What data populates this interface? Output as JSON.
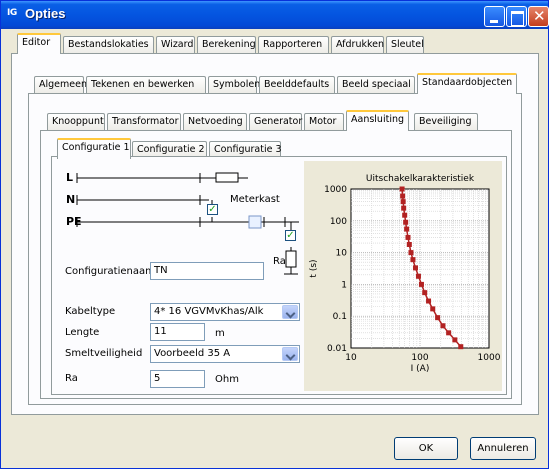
{
  "window": {
    "title": "Opties",
    "app_icon": "IG"
  },
  "tabs_level1": [
    "Editor",
    "Bestandslokaties",
    "Wizard",
    "Berekening",
    "Rapporteren",
    "Afdrukken",
    "Sleutel"
  ],
  "tabs_level2": [
    "Algemeen",
    "Tekenen en bewerken",
    "Symbolen",
    "Beelddefaults",
    "Beeld speciaal",
    "Standaardobjecten"
  ],
  "tabs_level3": [
    "Knooppunt",
    "Transformator",
    "Netvoeding",
    "Generator",
    "Motor",
    "Aansluiting",
    "Beveiliging"
  ],
  "tabs_level4": [
    "Configuratie 1",
    "Configuratie 2",
    "Configuratie 3"
  ],
  "active": {
    "l1": "Editor",
    "l2": "Standaardobjecten",
    "l3": "Aansluiting",
    "l4": "Configuratie 1"
  },
  "diagram": {
    "l": "L",
    "n": "N",
    "pe": "PE",
    "meterkast": "Meterkast",
    "ra": "Ra"
  },
  "form": {
    "configuratienaam_label": "Configuratienaam",
    "configuratienaam_value": "TN",
    "kabeltype_label": "Kabeltype",
    "kabeltype_value": "4* 16 VGVMvKhas/Alk",
    "lengte_label": "Lengte",
    "lengte_value": "11",
    "lengte_unit": "m",
    "smeltveiligheid_label": "Smeltveiligheid",
    "smeltveiligheid_value": "Voorbeeld 35 A",
    "ra_label": "Ra",
    "ra_value": "5",
    "ra_unit": "Ohm"
  },
  "buttons": {
    "ok": "OK",
    "annuleren": "Annuleren"
  },
  "chart_data": {
    "type": "line",
    "title": "Uitschakelkarakteristiek",
    "xlabel": "I (A)",
    "ylabel": "t (s)",
    "xscale": "log",
    "yscale": "log",
    "xlim": [
      10,
      1000
    ],
    "ylim": [
      0.01,
      1000
    ],
    "xticks": [
      "10",
      "100",
      "1000"
    ],
    "yticks": [
      "1000",
      "100",
      "10",
      "1",
      "0.1",
      "0.01"
    ],
    "grid": true,
    "color": "#b22222",
    "points": [
      [
        55,
        1000
      ],
      [
        56,
        600
      ],
      [
        57,
        400
      ],
      [
        58,
        250
      ],
      [
        60,
        150
      ],
      [
        62,
        90
      ],
      [
        64,
        55
      ],
      [
        67,
        30
      ],
      [
        70,
        18
      ],
      [
        74,
        10
      ],
      [
        79,
        6
      ],
      [
        86,
        3.3
      ],
      [
        95,
        1.8
      ],
      [
        105,
        1
      ],
      [
        117,
        0.55
      ],
      [
        133,
        0.3
      ],
      [
        153,
        0.17
      ],
      [
        180,
        0.09
      ],
      [
        215,
        0.05
      ],
      [
        260,
        0.03
      ],
      [
        320,
        0.018
      ],
      [
        390,
        0.011
      ]
    ]
  },
  "icons": {
    "window_close": "close-icon",
    "window_max": "maximize-icon",
    "window_min": "minimize-icon"
  }
}
